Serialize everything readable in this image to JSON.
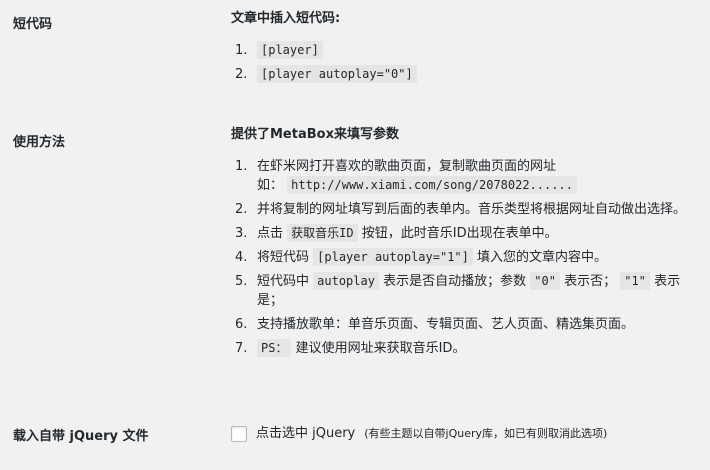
{
  "shortcode": {
    "label": "短代码",
    "heading": "文章中插入短代码:",
    "items": [
      {
        "num": "1.",
        "code": "[player]"
      },
      {
        "num": "2.",
        "code": "[player autoplay=\"0\"]"
      }
    ]
  },
  "usage": {
    "label": "使用方法",
    "heading": "提供了MetaBox来填写参数",
    "items": [
      {
        "num": "1.",
        "text_a": "在虾米网打开喜欢的歌曲页面，复制歌曲页面的网址",
        "text_b": "如：",
        "code": "http://www.xiami.com/song/2078022......"
      },
      {
        "num": "2.",
        "text": "并将复制的网址填写到后面的表单内。音乐类型将根据网址自动做出选择。"
      },
      {
        "num": "3.",
        "text_a": "点击",
        "code": "获取音乐ID",
        "text_b": "按钮，此时音乐ID出现在表单中。"
      },
      {
        "num": "4.",
        "text_a": "将短代码",
        "code": "[player autoplay=\"1\"]",
        "text_b": "填入您的文章内容中。"
      },
      {
        "num": "5.",
        "text_a": "短代码中",
        "code_a": "autoplay",
        "text_b": "表示是否自动播放；参数",
        "code_b": "\"0\"",
        "text_c": "表示否；",
        "code_c": "\"1\"",
        "text_d": "表示是；"
      },
      {
        "num": "6.",
        "text": "支持播放歌单：单音乐页面、专辑页面、艺人页面、精选集页面。"
      },
      {
        "num": "7.",
        "code": "PS：",
        "text": "建议使用网址来获取音乐ID。"
      }
    ]
  },
  "jquery": {
    "label": "载入自带 jQuery 文件",
    "checkbox_label": "点击选中 jQuery",
    "note": "(有些主题以自带jQuery库，如已有则取消此选项)",
    "checked": false
  }
}
